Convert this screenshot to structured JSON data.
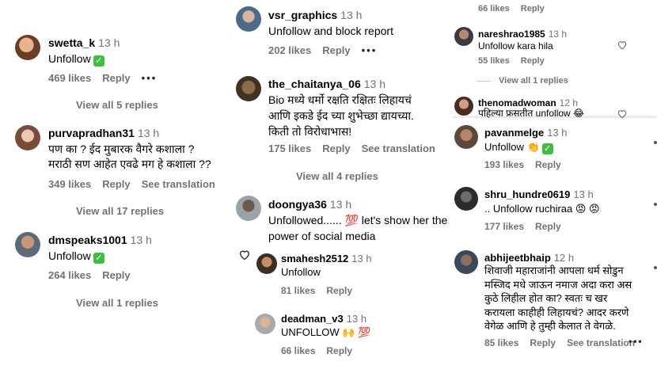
{
  "left": {
    "comments": [
      {
        "user": "swetta_k",
        "time": "13 h",
        "text": "Unfollow",
        "likes": "469 likes",
        "reply": "Reply",
        "view": "View all 5 replies"
      },
      {
        "user": "purvapradhan31",
        "time": "13 h",
        "text": "पण का ? ईद मुबारक वैगरे कशाला ?\nमराठी सण आहेत एवढे मग हे कशाला ??",
        "likes": "349 likes",
        "reply": "Reply",
        "translate": "See translation",
        "view": "View all 17 replies"
      },
      {
        "user": "dmspeaks1001",
        "time": "13 h",
        "text": "Unfollow",
        "likes": "264 likes",
        "reply": "Reply",
        "view": "View all 1 replies"
      }
    ]
  },
  "middle": {
    "comments": [
      {
        "user": "vsr_graphics",
        "time": "13 h",
        "text": "Unfollow and block report",
        "likes": "202 likes",
        "reply": "Reply"
      },
      {
        "user": "the_chaitanya_06",
        "time": "13 h",
        "text": "Bio मध्ये धर्मो रक्षति रक्षितः लिहायचं\nआणि इकडे ईद च्या शुभेच्छा द्यायच्या.\nकिती तो विरोधाभास!",
        "likes": "175 likes",
        "reply": "Reply",
        "translate": "See translation",
        "view": "View all 4 replies"
      },
      {
        "user": "doongya36",
        "time": "13 h",
        "text": "Unfollowed...... 💯 let's show her the\npower of social media"
      }
    ],
    "replies": [
      {
        "user": "smahesh2512",
        "time": "13 h",
        "text": "Unfollow",
        "likes": "81 likes",
        "reply": "Reply"
      },
      {
        "user": "deadman_v3",
        "time": "13 h",
        "text": "UNFOLLOW 🙌 💯",
        "likes": "66 likes",
        "reply": "Reply"
      }
    ]
  },
  "right": {
    "top_meta": {
      "likes": "66 likes",
      "reply": "Reply"
    },
    "replies": [
      {
        "user": "nareshrao1985",
        "time": "13 h",
        "text": "Unfollow kara hila",
        "likes": "55 likes",
        "reply": "Reply"
      },
      {
        "user": "thenomadwoman",
        "time": "12 h",
        "text": "पहिल्या फ्रसतीत unfollow 😂"
      }
    ],
    "view_replies": "View all 1 replies",
    "comments": [
      {
        "user": "pavanmelge",
        "time": "13 h",
        "text": "Unfollow 👏",
        "likes": "193 likes",
        "reply": "Reply"
      },
      {
        "user": "shru_hundre0619",
        "time": "13 h",
        "text": ".. Unfollow ruchiraa 😡 😡",
        "likes": "177 likes",
        "reply": "Reply"
      },
      {
        "user": "abhijeetbhaip",
        "time": "12 h",
        "text": "शिवाजी महाराजांनी आपला धर्म सोडुन\nमस्जिद मधे जाऊन नमाज अदा करा अस\nकुठे लिहील होत का? स्वतः च खर\nकरायला काहीही लिहायचं? आदर करणे\nवेगेळ आणि हे तुम्ही केलात ते वेगळे.",
        "likes": "85 likes",
        "reply": "Reply",
        "translate": "See translation"
      }
    ]
  }
}
